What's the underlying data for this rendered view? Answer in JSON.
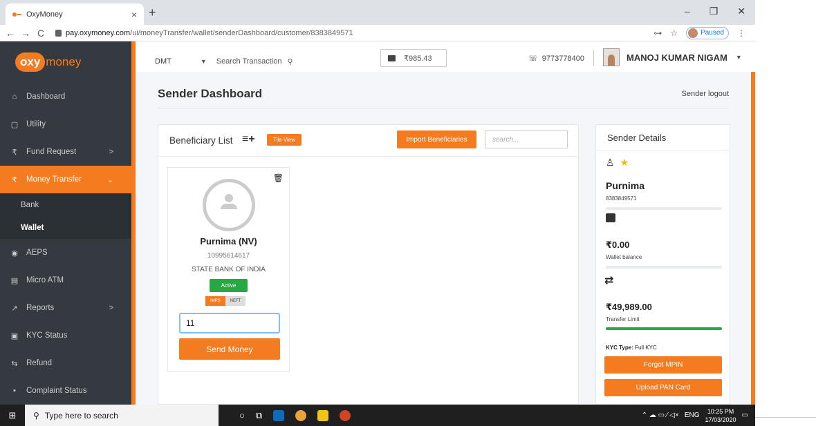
{
  "browser": {
    "tab_title": "OxyMoney",
    "tab_close": "×",
    "new_tab": "+",
    "window_controls": [
      "–",
      "❐",
      "✕"
    ],
    "url_host": "pay.oxymoney.com",
    "url_path": "/ui/moneyTransfer/wallet/senderDashboard/customer/8383849571",
    "paused_label": "Paused",
    "nav": {
      "back": "←",
      "forward": "→",
      "reload": "C",
      "key": "⊶",
      "star": "☆",
      "menu": "⋮"
    }
  },
  "brand": {
    "oxy": "oxy",
    "money": "money",
    "color": "#f47b20"
  },
  "sidebar": {
    "items": [
      {
        "label": "Dashboard",
        "icon": "home-icon",
        "glyph": "⌂"
      },
      {
        "label": "Utility",
        "icon": "square-icon",
        "glyph": "▢"
      },
      {
        "label": "Fund Request",
        "icon": "rupee-icon",
        "glyph": "₹",
        "arrow": ">"
      },
      {
        "label": "Money Transfer",
        "icon": "rupee-icon",
        "glyph": "₹",
        "arrow": "⌄"
      },
      {
        "label": "AEPS",
        "icon": "fingerprint-icon",
        "glyph": "◉"
      },
      {
        "label": "Micro ATM",
        "icon": "atm-icon",
        "glyph": "▤"
      },
      {
        "label": "Reports",
        "icon": "chart-icon",
        "glyph": "↗",
        "arrow": ">"
      },
      {
        "label": "KYC Status",
        "icon": "id-card-icon",
        "glyph": "▣"
      },
      {
        "label": "Refund",
        "icon": "refund-icon",
        "glyph": "⇆"
      },
      {
        "label": "Complaint Status",
        "icon": "complaint-icon",
        "glyph": "▪"
      }
    ],
    "sub_items": [
      "Bank",
      "Wallet"
    ]
  },
  "topbar": {
    "service": "DMT",
    "service_caret": "▼",
    "search_label": "Search Transaction",
    "search_glyph": "⚲",
    "wallet_balance": "₹985.43",
    "phone_glyph": "☏",
    "phone": "9773778400",
    "user_name": "MANOJ KUMAR NIGAM",
    "user_caret": "▼"
  },
  "page": {
    "title": "Sender Dashboard",
    "logout": "Sender logout"
  },
  "beneficiary": {
    "list_title": "Beneficiary List",
    "list_icon_glyph": "≡+",
    "tile_view": "Tile View",
    "import_label": "Import Beneficiaries",
    "search_placeholder": "search...",
    "trash_glyph": "🗑",
    "card": {
      "name": "Purnima (NV)",
      "account": "10995614617",
      "bank": "STATE BANK OF INDIA",
      "status": "Active",
      "modes": [
        "IMPS",
        "NEFT"
      ],
      "amount_value": "11",
      "send_label": "Send Money"
    }
  },
  "sender": {
    "title": "Sender Details",
    "user_glyph": "♙",
    "star_glyph": "★",
    "name": "Purnima",
    "mobile": "8383849571",
    "wallet_balance": "₹0.00",
    "wallet_balance_label": "Wallet balance",
    "transfer_glyph": "⇄",
    "transfer_limit": "₹49,989.00",
    "transfer_limit_label": "Transfer Limit",
    "transfer_limit_bar_color": "#28a745",
    "kyc_label": "KYC Type:",
    "kyc_value": "Full KYC",
    "forgot_mpin": "Forgot MPIN",
    "upload_pan": "Upload PAN Card"
  },
  "taskbar": {
    "start_glyph": "⊞",
    "search_glyph": "⚲",
    "search_placeholder": "Type here to search",
    "cortana_glyph": "○",
    "taskview_glyph": "⧉",
    "tray_glyphs": "⌃ ☁ ▭ ⁄ ◁×",
    "lang": "ENG",
    "time": "10:25 PM",
    "date": "17/03/2020",
    "notify_glyph": "▭"
  }
}
